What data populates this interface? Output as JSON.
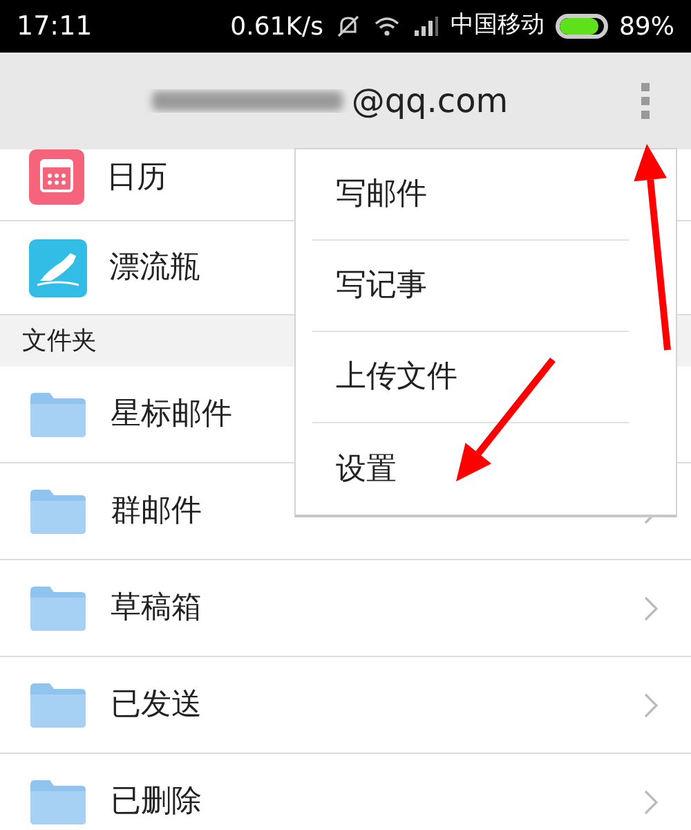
{
  "status_bar": {
    "time": "17:11",
    "speed": "0.61K/s",
    "carrier": "中国移动",
    "battery": {
      "level": 0.89,
      "text": "89%"
    }
  },
  "header": {
    "account": "@qq.com"
  },
  "apps": [
    {
      "kind": "calendar",
      "label": "日历"
    },
    {
      "kind": "bottle",
      "label": "漂流瓶"
    }
  ],
  "section": "文件夹",
  "folders": [
    {
      "label": "星标邮件"
    },
    {
      "label": "群邮件"
    },
    {
      "label": "草稿箱"
    },
    {
      "label": "已发送"
    },
    {
      "label": "已删除"
    }
  ],
  "menu": [
    "写邮件",
    "写记事",
    "上传文件",
    "设置"
  ]
}
